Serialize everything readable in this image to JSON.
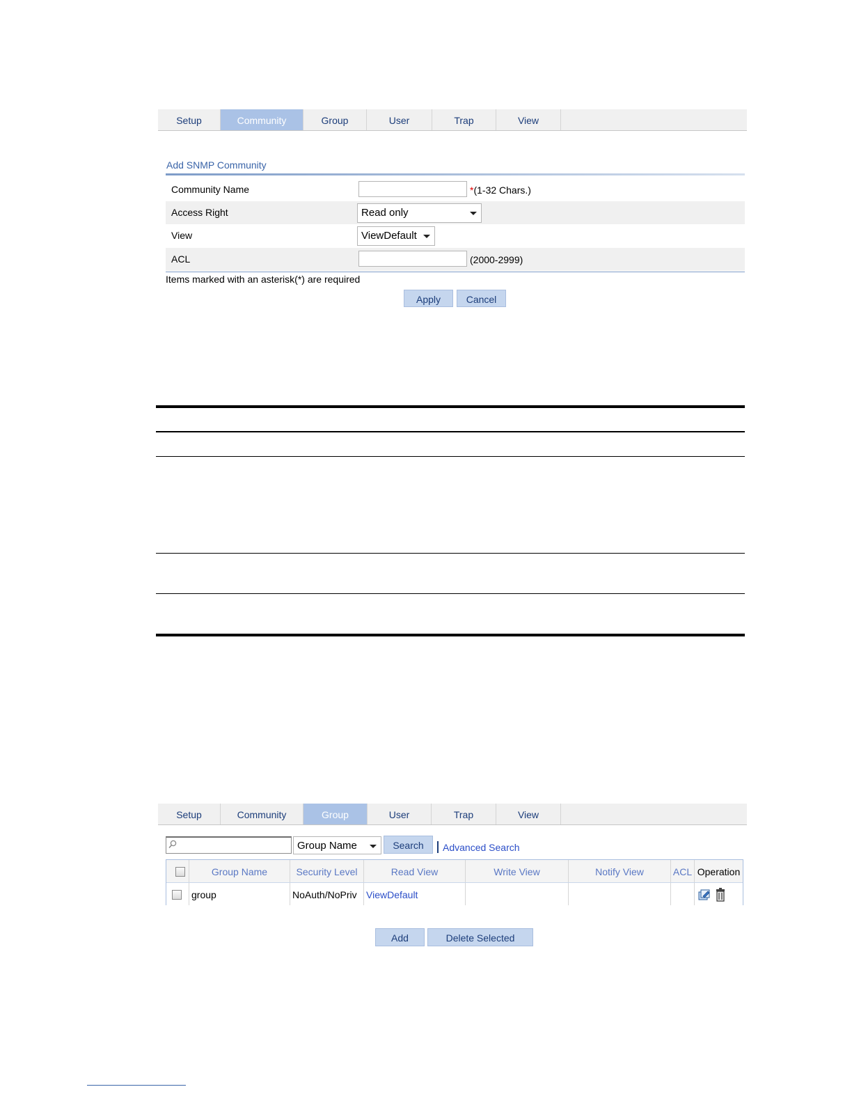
{
  "top_tabs": {
    "items": [
      "Setup",
      "Community",
      "Group",
      "User",
      "Trap",
      "View"
    ],
    "active": "Community"
  },
  "community_form": {
    "title": "Add SNMP Community",
    "community_name_label": "Community Name",
    "community_name_value": "",
    "community_name_star": "*",
    "community_name_hint": "(1-32 Chars.)",
    "access_right_label": "Access Right",
    "access_right_value": "Read only",
    "view_label": "View",
    "view_value": "ViewDefault",
    "acl_label": "ACL",
    "acl_value": "",
    "acl_hint": "(2000-2999)",
    "required_note": "Items marked with an asterisk(*) are required",
    "apply_label": "Apply",
    "cancel_label": "Cancel"
  },
  "bottom_tabs": {
    "items": [
      "Setup",
      "Community",
      "Group",
      "User",
      "Trap",
      "View"
    ],
    "active": "Group"
  },
  "group_list": {
    "search_value": "",
    "filter_field": "Group Name",
    "search_label": "Search",
    "advanced_search_label": "Advanced Search",
    "columns": [
      "Group Name",
      "Security Level",
      "Read View",
      "Write View",
      "Notify View",
      "ACL",
      "Operation"
    ],
    "rows": [
      {
        "group_name": "group",
        "security_level": "NoAuth/NoPriv",
        "read_view": "ViewDefault",
        "write_view": "",
        "notify_view": "",
        "acl": ""
      }
    ],
    "operation_icons": [
      "edit-icon",
      "trash-icon"
    ],
    "add_label": "Add",
    "delete_selected_label": "Delete Selected"
  }
}
